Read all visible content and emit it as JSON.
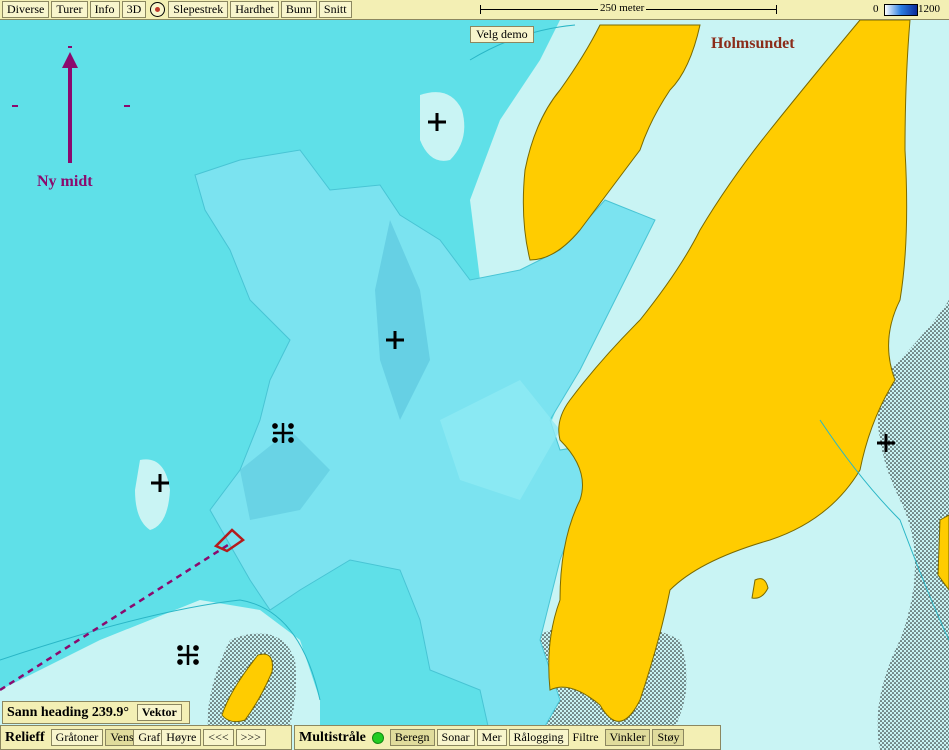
{
  "toolbar": {
    "items": [
      "Diverse",
      "Turer",
      "Info",
      "3D",
      "Slepestrek",
      "Hardhet",
      "Bunn",
      "Snitt"
    ],
    "scale_label": "250 meter",
    "legend_min": "0",
    "legend_max": "1200"
  },
  "map": {
    "demo_button": "Velg demo",
    "place_name": "Holmsundet",
    "north_label": "Ny midt",
    "colors": {
      "sea_deep": "#5fe0e8",
      "sea_shallow": "#c9f4f4",
      "land": "#ffcc00",
      "survey": "#7be3f0",
      "track": "#8b0a6e"
    }
  },
  "heading_panel": {
    "text": "Sann heading 239.9°",
    "button": "Vektor"
  },
  "relieff_panel": {
    "title": "Relieff",
    "buttons": [
      "Gråtoner",
      "Venstre",
      "Graf",
      "Høyre",
      "<<<",
      ">>>"
    ]
  },
  "multistraale_panel": {
    "title": "Multistråle",
    "buttons": [
      "Beregn",
      "Sonar",
      "Mer",
      "Rålogging"
    ],
    "filter_label": "Filtre",
    "filter_buttons": [
      "Vinkler",
      "Støy"
    ]
  }
}
